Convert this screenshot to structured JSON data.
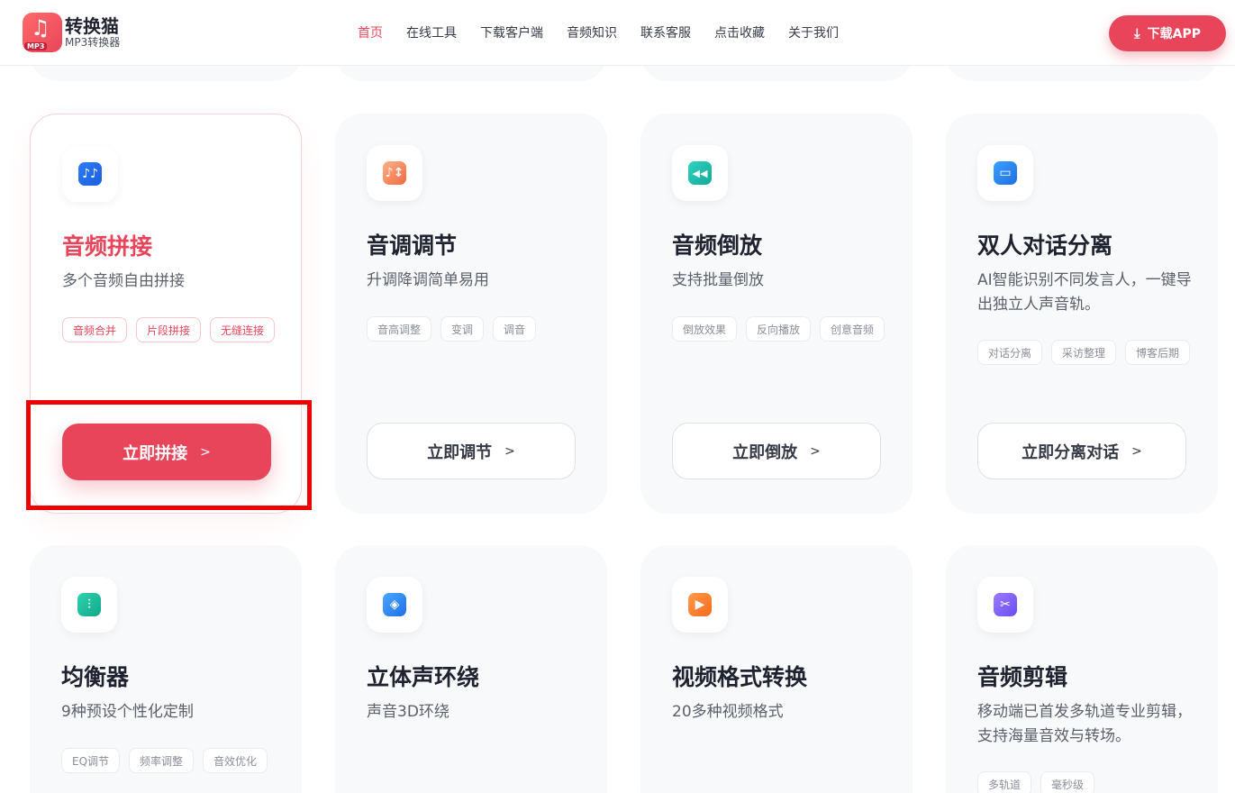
{
  "header": {
    "logo_title": "转换猫",
    "logo_subtitle": "MP3转换器",
    "logo_badge": "MP3",
    "nav": [
      "首页",
      "在线工具",
      "下载客户端",
      "音频知识",
      "联系客服",
      "点击收藏",
      "关于我们"
    ],
    "download_label": "下载APP"
  },
  "colors": {
    "accent": "#e9455a",
    "card_bg": "#f8f9fb",
    "text": "#1f2330"
  },
  "cards": [
    {
      "icon": "music-notes-icon",
      "icon_glyph": "♪♪",
      "title": "音频拼接",
      "desc": "多个音频自由拼接",
      "tags": [
        "音频合并",
        "片段拼接",
        "无缝连接"
      ],
      "cta": "立即拼接"
    },
    {
      "icon": "pitch-adjust-icon",
      "icon_glyph": "♪↕",
      "title": "音调调节",
      "desc": "升调降调简单易用",
      "tags": [
        "音高调整",
        "变调",
        "调音"
      ],
      "cta": "立即调节"
    },
    {
      "icon": "rewind-icon",
      "icon_glyph": "◀◀",
      "title": "音频倒放",
      "desc": "支持批量倒放",
      "tags": [
        "倒放效果",
        "反向播放",
        "创意音频"
      ],
      "cta": "立即倒放"
    },
    {
      "icon": "chat-bubbles-icon",
      "icon_glyph": "▭",
      "title": "双人对话分离",
      "desc": "AI智能识别不同发言人，一键导出独立人声音轨。",
      "tags": [
        "对话分离",
        "采访整理",
        "博客后期"
      ],
      "cta": "立即分离对话"
    },
    {
      "icon": "equalizer-icon",
      "icon_glyph": "⫶",
      "title": "均衡器",
      "desc": "9种预设个性化定制",
      "tags": [
        "EQ调节",
        "频率调整",
        "音效优化"
      ],
      "cta": ""
    },
    {
      "icon": "cube-icon",
      "icon_glyph": "◈",
      "title": "立体声环绕",
      "desc": "声音3D环绕",
      "tags": [],
      "cta": ""
    },
    {
      "icon": "video-play-icon",
      "icon_glyph": "▶",
      "title": "视频格式转换",
      "desc": "20多种视频格式",
      "tags": [],
      "cta": ""
    },
    {
      "icon": "scissors-icon",
      "icon_glyph": "✂",
      "title": "音频剪辑",
      "desc": "移动端已首发多轨道专业剪辑，支持海量音效与转场。",
      "tags": [
        "多轨道",
        "毫秒级"
      ],
      "cta": ""
    }
  ]
}
